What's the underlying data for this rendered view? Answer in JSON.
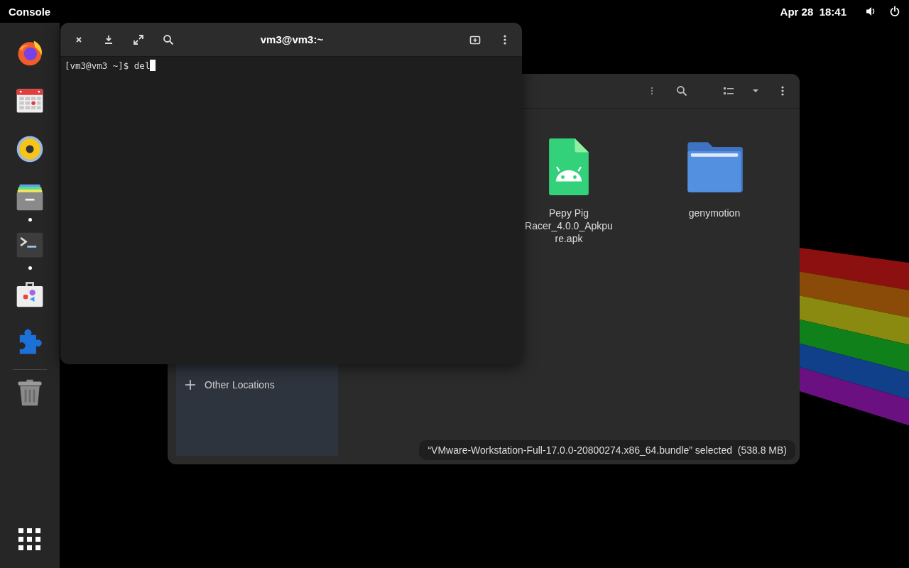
{
  "top_bar": {
    "activities": "Console",
    "clock": "Apr 28  18:41"
  },
  "dock": {
    "items": [
      {
        "kind": "firefox",
        "running": false
      },
      {
        "kind": "calendar",
        "running": false
      },
      {
        "kind": "speaker",
        "running": false
      },
      {
        "kind": "files",
        "running": true
      },
      {
        "kind": "terminal",
        "running": true
      },
      {
        "kind": "software",
        "running": false
      },
      {
        "kind": "extensions",
        "running": false
      },
      {
        "kind": "trash",
        "running": false
      }
    ]
  },
  "files_window": {
    "items": [
      {
        "kind": "apk",
        "name": "Pepy Pig Racer_4.0.0_Apkpure.apk"
      },
      {
        "kind": "folder",
        "name": "genymotion"
      }
    ],
    "sidebar": {
      "items": [
        {
          "label": "Other Locations"
        }
      ]
    },
    "status": "“VMware-Workstation-Full-17.0.0-20800274.x86_64.bundle” selected  (538.8 MB)"
  },
  "terminal_window": {
    "title": "vm3@vm3:~",
    "prompt": "[vm3@vm3 ~]$ ",
    "input": "del"
  }
}
